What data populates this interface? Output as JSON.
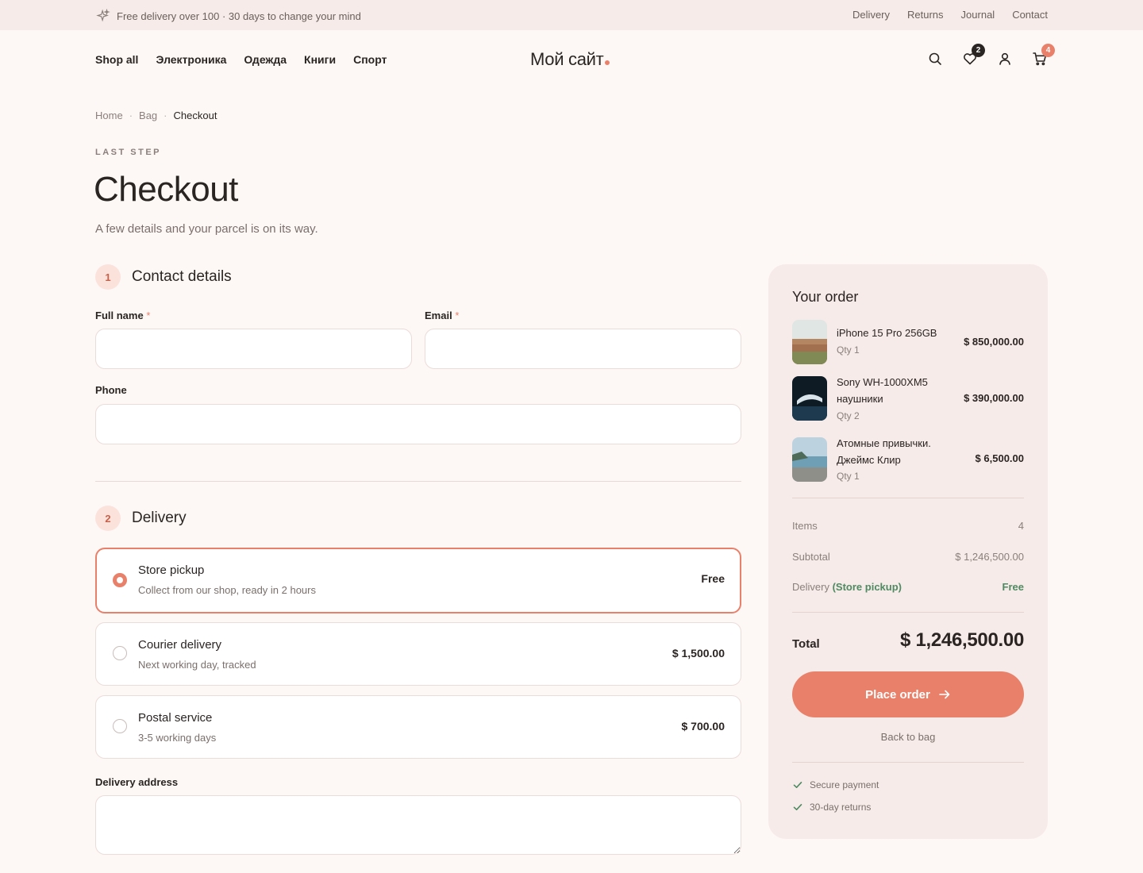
{
  "topbar": {
    "promo": "Free delivery over 100 · 30 days to change your mind",
    "links": [
      "Delivery",
      "Returns",
      "Journal",
      "Contact"
    ]
  },
  "header": {
    "nav": [
      "Shop all",
      "Электроника",
      "Одежда",
      "Книги",
      "Спорт"
    ],
    "logo": "Мой сайт",
    "wishlist_count": "2",
    "cart_count": "4",
    "accent_color": "#e8806a"
  },
  "breadcrumb": {
    "items": [
      "Home",
      "Bag",
      "Checkout"
    ],
    "separator": "·"
  },
  "hero": {
    "eyebrow": "LAST STEP",
    "title": "Checkout",
    "subtitle": "A few details and your parcel is on its way."
  },
  "contact": {
    "step": "1",
    "title": "Contact details",
    "full_name_label": "Full name",
    "email_label": "Email",
    "phone_label": "Phone",
    "required_mark": "*",
    "full_name_value": "",
    "email_value": "",
    "phone_value": ""
  },
  "delivery": {
    "step": "2",
    "title": "Delivery",
    "options": [
      {
        "title": "Store pickup",
        "desc": "Collect from our shop, ready in 2 hours",
        "price": "Free",
        "selected": true
      },
      {
        "title": "Courier delivery",
        "desc": "Next working day, tracked",
        "price": "$ 1,500.00",
        "selected": false
      },
      {
        "title": "Postal service",
        "desc": "3-5 working days",
        "price": "$ 700.00",
        "selected": false
      }
    ],
    "address_label": "Delivery address",
    "address_value": ""
  },
  "order": {
    "title": "Your order",
    "items": [
      {
        "name": "iPhone 15 Pro 256GB",
        "qty": "Qty 1",
        "price": "$ 850,000.00"
      },
      {
        "name": "Sony WH-1000XM5 наушники",
        "qty": "Qty 2",
        "price": "$ 390,000.00"
      },
      {
        "name": "Атомные привычки. Джеймс Клир",
        "qty": "Qty 1",
        "price": "$ 6,500.00"
      }
    ],
    "items_label": "Items",
    "items_value": "4",
    "subtotal_label": "Subtotal",
    "subtotal_value": "$ 1,246,500.00",
    "delivery_label": "Delivery",
    "delivery_method": "(Store pickup)",
    "delivery_value": "Free",
    "total_label": "Total",
    "total_value": "$ 1,246,500.00",
    "place_order": "Place order",
    "back_to_bag": "Back to bag",
    "features": [
      "Secure payment",
      "30-day returns"
    ]
  }
}
